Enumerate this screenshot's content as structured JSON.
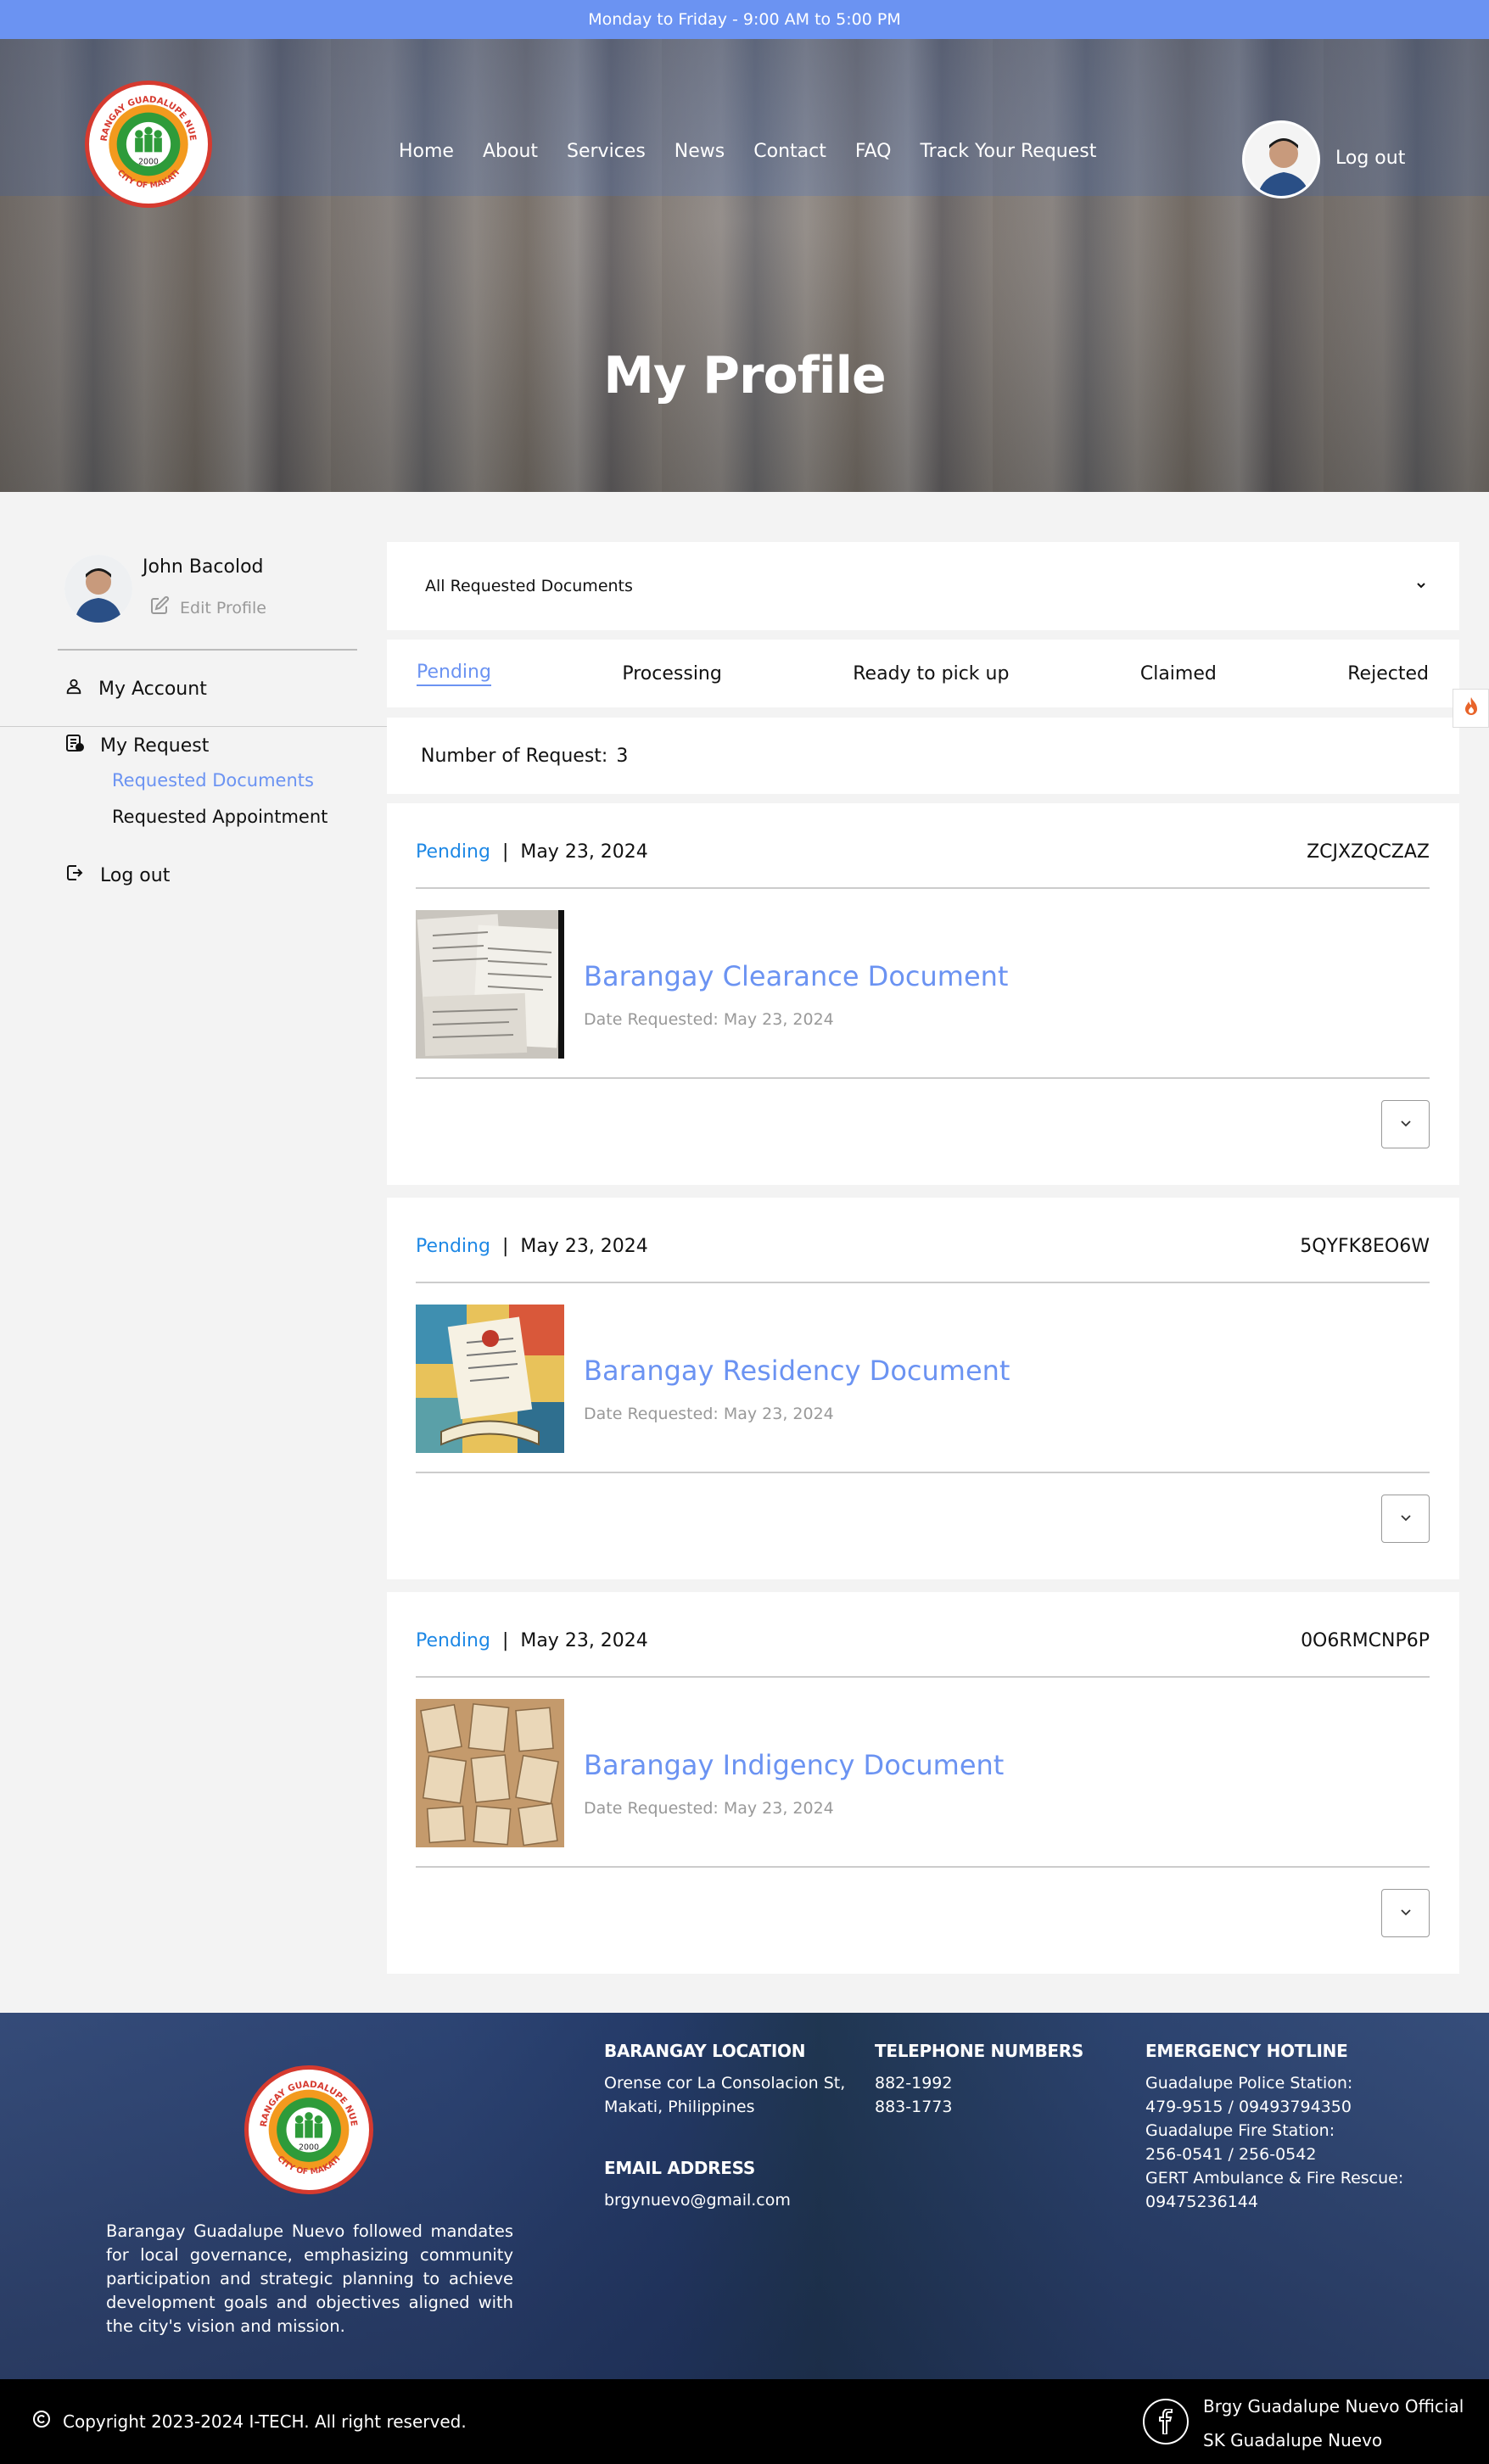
{
  "topbar": {
    "hours": "Monday to Friday - 9:00 AM to 5:00 PM"
  },
  "nav": {
    "items": [
      "Home",
      "About",
      "Services",
      "News",
      "Contact",
      "FAQ",
      "Track Your Request"
    ],
    "logout": "Log out"
  },
  "hero": {
    "title": "My Profile"
  },
  "sidebar": {
    "name": "John Bacolod",
    "edit_profile": "Edit Profile",
    "my_account": "My Account",
    "my_request": "My Request",
    "requested_documents": "Requested Documents",
    "requested_appointment": "Requested Appointment",
    "logout": "Log out"
  },
  "filter": {
    "selected": "All Requested Documents"
  },
  "tabs": [
    "Pending",
    "Processing",
    "Ready to pick up",
    "Claimed",
    "Rejected"
  ],
  "count": {
    "label": "Number of Request:",
    "value": "3"
  },
  "requests": [
    {
      "status": "Pending",
      "date": "May 23, 2024",
      "code": "ZCJXZQCZAZ",
      "title": "Barangay Clearance Document",
      "date_requested": "Date Requested: May 23, 2024"
    },
    {
      "status": "Pending",
      "date": "May 23, 2024",
      "code": "5QYFK8EO6W",
      "title": "Barangay Residency Document",
      "date_requested": "Date Requested: May 23, 2024"
    },
    {
      "status": "Pending",
      "date": "May 23, 2024",
      "code": "0O6RMCNP6P",
      "title": "Barangay Indigency Document",
      "date_requested": "Date Requested: May 23, 2024"
    }
  ],
  "footer": {
    "description": "Barangay Guadalupe Nuevo followed mandates for local governance, emphasizing community participation and strategic planning to achieve development goals and objectives aligned with the city's vision and mission.",
    "location_title": "BARANGAY LOCATION",
    "location_1": "Orense cor La Consolacion St,",
    "location_2": "Makati, Philippines",
    "email_title": "EMAIL ADDRESS",
    "email": "brgynuevo@gmail.com",
    "phone_title": "TELEPHONE NUMBERS",
    "phone_1": "882-1992",
    "phone_2": "883-1773",
    "emergency_title": "EMERGENCY HOTLINE",
    "emergency": [
      "Guadalupe Police Station:",
      "479-9515 / 09493794350",
      "Guadalupe Fire Station:",
      "256-0541 / 256-0542",
      "GERT Ambulance & Fire Rescue:",
      "09475236144"
    ],
    "copyright": "Copyright 2023-2024 I-TECH. All right reserved.",
    "fb_1": "Brgy Guadalupe Nuevo Official",
    "fb_2": "SK Guadalupe Nuevo"
  },
  "logo": {
    "top_text": "BARANGAY GUADALUPE NUEVO",
    "bottom_text": "CITY OF MAKATI",
    "year": "2000"
  },
  "colors": {
    "accent": "#6b93f2",
    "status": "#1e88e5",
    "topbar": "#6b93f2"
  }
}
